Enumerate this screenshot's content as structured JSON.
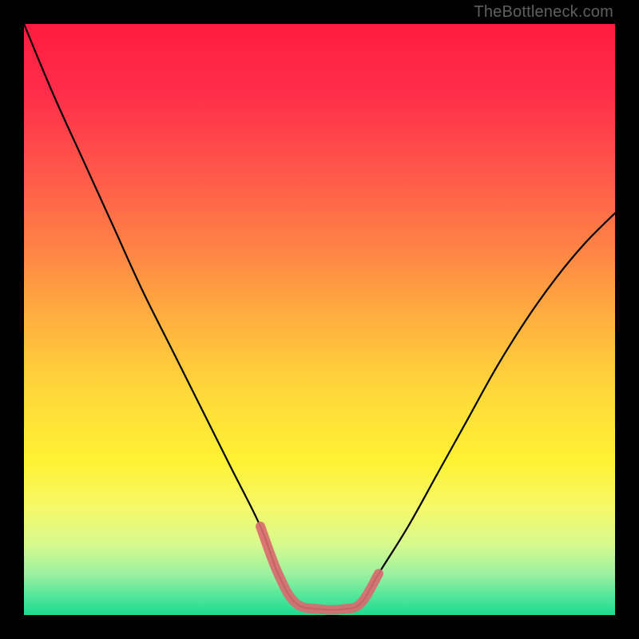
{
  "watermark": "TheBottleneck.com",
  "chart_data": {
    "type": "line",
    "title": "",
    "xlabel": "",
    "ylabel": "",
    "xlim": [
      0,
      100
    ],
    "ylim": [
      0,
      100
    ],
    "grid": false,
    "legend": false,
    "series": [
      {
        "name": "bottleneck-curve",
        "color": "#000000",
        "x": [
          0,
          5,
          10,
          15,
          20,
          25,
          30,
          35,
          40,
          43,
          46,
          50,
          54,
          57,
          60,
          65,
          70,
          75,
          80,
          85,
          90,
          95,
          100
        ],
        "values": [
          100,
          88,
          77,
          66,
          55,
          45,
          35,
          25,
          15,
          7,
          2,
          1,
          1,
          2,
          7,
          15,
          24,
          33,
          42,
          50,
          57,
          63,
          68
        ]
      },
      {
        "name": "ideal-zone",
        "color": "#d86b6f",
        "x": [
          40,
          43,
          46,
          50,
          54,
          57,
          60
        ],
        "values": [
          15,
          7,
          2,
          1,
          1,
          2,
          7
        ]
      }
    ],
    "gradient_stops": [
      {
        "offset": 0.0,
        "color": "#ff1b3f"
      },
      {
        "offset": 0.12,
        "color": "#ff2e4a"
      },
      {
        "offset": 0.25,
        "color": "#ff584a"
      },
      {
        "offset": 0.38,
        "color": "#ff8345"
      },
      {
        "offset": 0.5,
        "color": "#ffb03f"
      },
      {
        "offset": 0.62,
        "color": "#ffd83a"
      },
      {
        "offset": 0.74,
        "color": "#fff233"
      },
      {
        "offset": 0.82,
        "color": "#f5f96a"
      },
      {
        "offset": 0.88,
        "color": "#d8f98e"
      },
      {
        "offset": 0.93,
        "color": "#9df1a0"
      },
      {
        "offset": 0.97,
        "color": "#4ee69a"
      },
      {
        "offset": 1.0,
        "color": "#1ddc90"
      }
    ]
  }
}
